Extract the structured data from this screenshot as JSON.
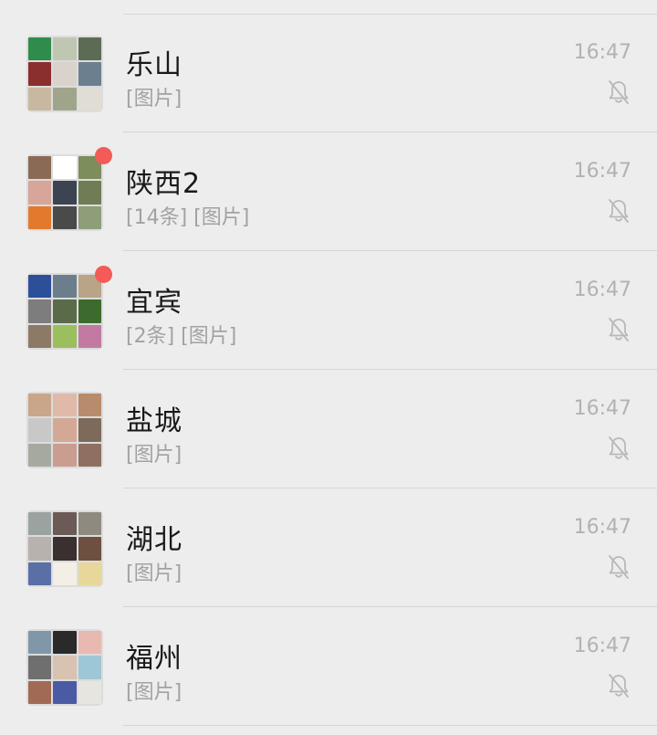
{
  "chats": [
    {
      "name": "乐山",
      "preview": "[图片]",
      "time": "16:47",
      "unread_dot": false,
      "muted": true,
      "avatar_colors": [
        "#2f8c4a",
        "#bfc7b2",
        "#5d6b55",
        "#8a2e2e",
        "#d9d3cb",
        "#6b7f8f",
        "#c9b8a0",
        "#9fa58a",
        "#e0ddd5"
      ]
    },
    {
      "name": "陕西2",
      "preview": "[14条] [图片]",
      "time": "16:47",
      "unread_dot": true,
      "muted": true,
      "avatar_colors": [
        "#8a6a55",
        "#ffffff",
        "#7d8d5c",
        "#d7a59a",
        "#3b4450",
        "#6f7d55",
        "#e3792d",
        "#4a4a4a",
        "#8d9e78"
      ]
    },
    {
      "name": "宜宾",
      "preview": "[2条] [图片]",
      "time": "16:47",
      "unread_dot": true,
      "muted": true,
      "avatar_colors": [
        "#2d4f9a",
        "#6c7e8c",
        "#b9a487",
        "#7d7d7d",
        "#5a6b4a",
        "#3d6b2e",
        "#8c7a66",
        "#9bbf5f",
        "#c27aa3"
      ]
    },
    {
      "name": "盐城",
      "preview": "[图片]",
      "time": "16:47",
      "unread_dot": false,
      "muted": true,
      "avatar_colors": [
        "#c9a58a",
        "#e0b9a8",
        "#b88b6d",
        "#c8c8c8",
        "#d3a995",
        "#7d6a5a",
        "#a5a9a0",
        "#c99d8f",
        "#8f6f62"
      ]
    },
    {
      "name": "湖北",
      "preview": "[图片]",
      "time": "16:47",
      "unread_dot": false,
      "muted": true,
      "avatar_colors": [
        "#9aa3a0",
        "#6b5a55",
        "#8e8a80",
        "#b7b2ad",
        "#3a3030",
        "#6d5040",
        "#5a6fa5",
        "#f3efe6",
        "#e8d79a"
      ]
    },
    {
      "name": "福州",
      "preview": "[图片]",
      "time": "16:47",
      "unread_dot": false,
      "muted": true,
      "avatar_colors": [
        "#7f97a8",
        "#2a2a2a",
        "#e8b9b0",
        "#6f6f6f",
        "#d8c2b2",
        "#9ec7d6",
        "#a06a55",
        "#4a5aa5",
        "#e7e5e0"
      ]
    }
  ]
}
